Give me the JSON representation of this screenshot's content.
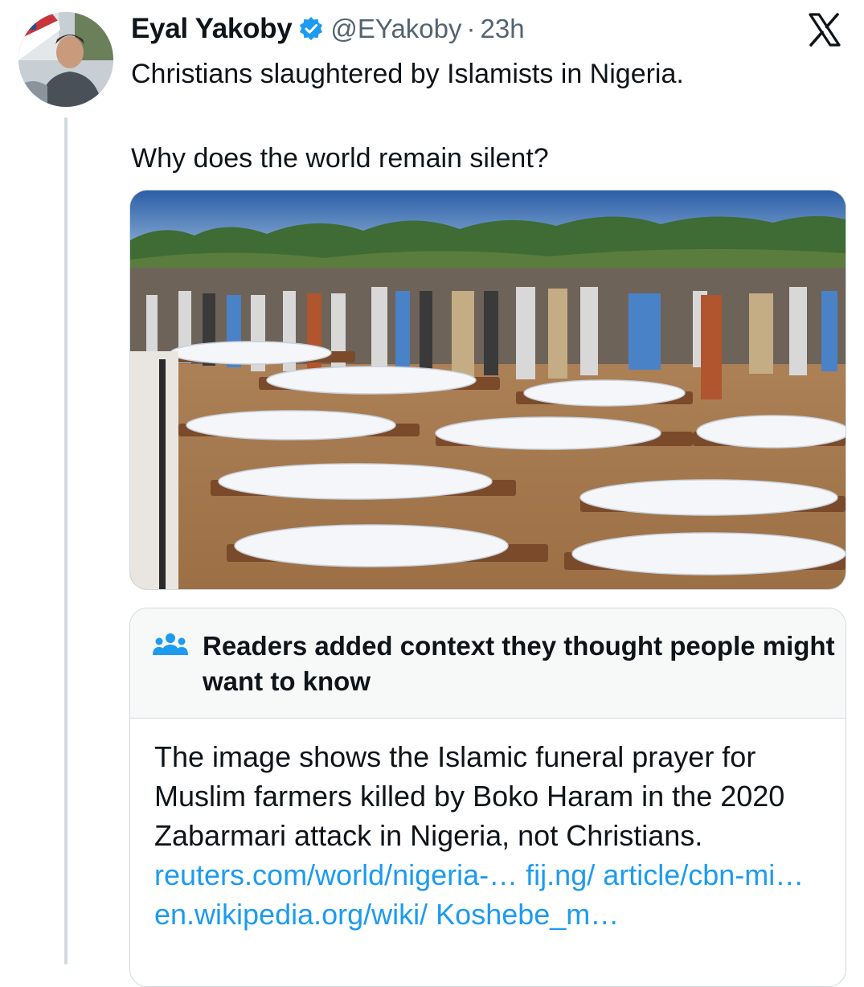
{
  "tweet": {
    "author_name": "Eyal Yakoby",
    "handle": "@EYakoby",
    "separator": "·",
    "time": "23h",
    "text_line1": "Christians slaughtered by Islamists in Nigeria.",
    "text_line2": "Why does the world remain silent?"
  },
  "community_note": {
    "title": "Readers added context they thought people might want to know",
    "body": "The image shows the Islamic funeral prayer for Muslim farmers killed by Boko Haram in the 2020 Zabarmari attack in Nigeria, not Christians.",
    "links": [
      "reuters.com/world/nigeria-…",
      "fij.ng/ article/cbn-mi…",
      "en.wikipedia.org/wiki/ Koshebe_m…"
    ]
  },
  "colors": {
    "link": "#1d9bf0",
    "verified_badge": "#1d9bf0",
    "secondary_text": "#536471",
    "note_header_bg": "#f7f9f9",
    "border": "#cfd9de"
  },
  "icons": {
    "verified": "verified-badge-icon",
    "brand": "x-logo-icon",
    "note": "people-group-icon"
  }
}
